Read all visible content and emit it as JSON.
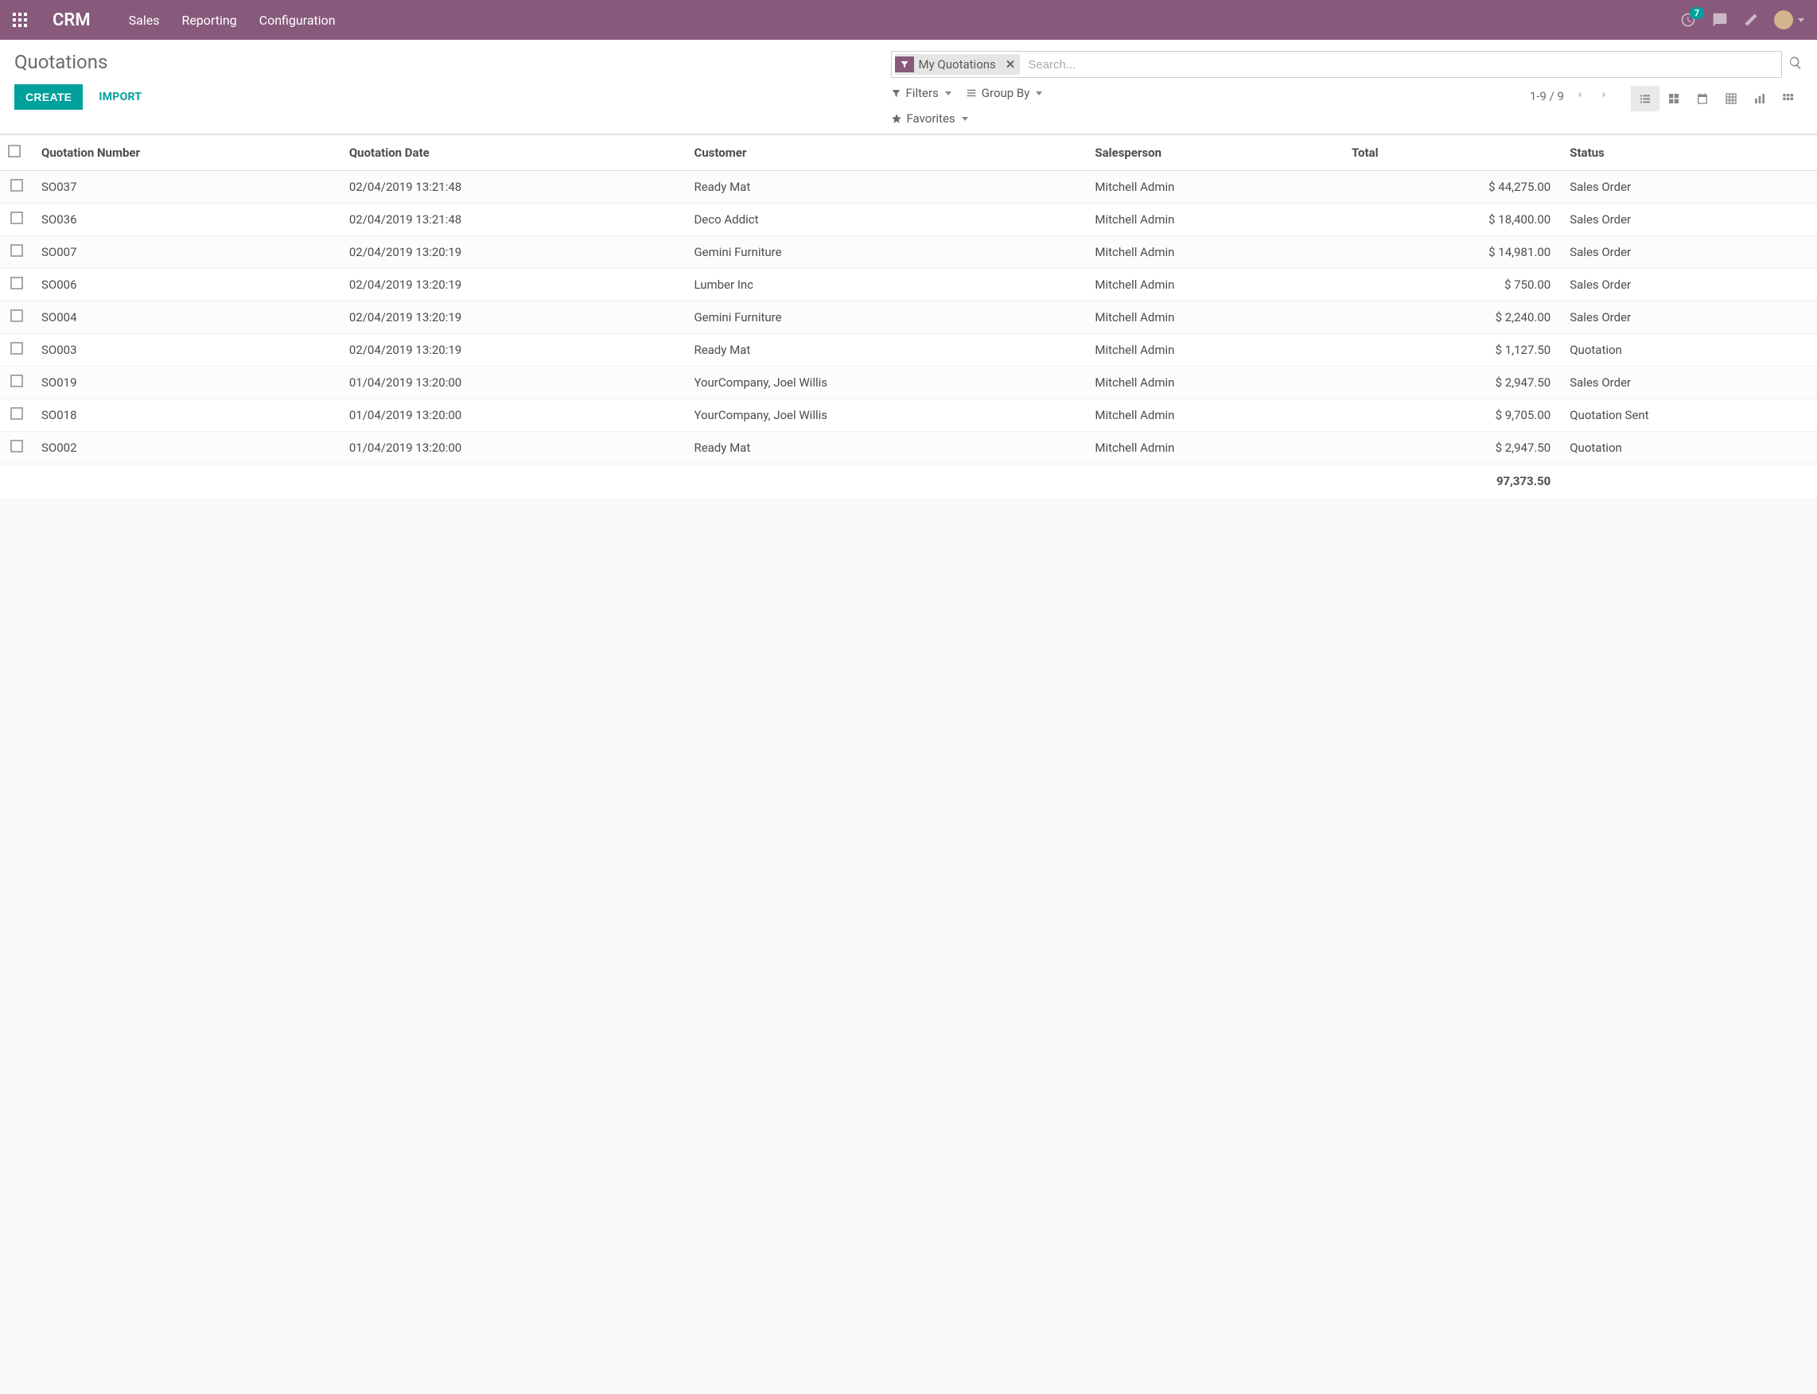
{
  "header": {
    "brand": "CRM",
    "menu": [
      "Sales",
      "Reporting",
      "Configuration"
    ],
    "notification_count": "7"
  },
  "control_panel": {
    "title": "Quotations",
    "create_label": "CREATE",
    "import_label": "IMPORT",
    "active_filter": "My Quotations",
    "search_placeholder": "Search...",
    "filters_label": "Filters",
    "groupby_label": "Group By",
    "favorites_label": "Favorites",
    "pager": "1-9 / 9"
  },
  "table": {
    "columns": {
      "number": "Quotation Number",
      "date": "Quotation Date",
      "customer": "Customer",
      "salesperson": "Salesperson",
      "total": "Total",
      "status": "Status"
    },
    "rows": [
      {
        "number": "SO037",
        "date": "02/04/2019 13:21:48",
        "customer": "Ready Mat",
        "salesperson": "Mitchell Admin",
        "total": "$ 44,275.00",
        "status": "Sales Order"
      },
      {
        "number": "SO036",
        "date": "02/04/2019 13:21:48",
        "customer": "Deco Addict",
        "salesperson": "Mitchell Admin",
        "total": "$ 18,400.00",
        "status": "Sales Order"
      },
      {
        "number": "SO007",
        "date": "02/04/2019 13:20:19",
        "customer": "Gemini Furniture",
        "salesperson": "Mitchell Admin",
        "total": "$ 14,981.00",
        "status": "Sales Order"
      },
      {
        "number": "SO006",
        "date": "02/04/2019 13:20:19",
        "customer": "Lumber Inc",
        "salesperson": "Mitchell Admin",
        "total": "$ 750.00",
        "status": "Sales Order"
      },
      {
        "number": "SO004",
        "date": "02/04/2019 13:20:19",
        "customer": "Gemini Furniture",
        "salesperson": "Mitchell Admin",
        "total": "$ 2,240.00",
        "status": "Sales Order"
      },
      {
        "number": "SO003",
        "date": "02/04/2019 13:20:19",
        "customer": "Ready Mat",
        "salesperson": "Mitchell Admin",
        "total": "$ 1,127.50",
        "status": "Quotation"
      },
      {
        "number": "SO019",
        "date": "01/04/2019 13:20:00",
        "customer": "YourCompany, Joel Willis",
        "salesperson": "Mitchell Admin",
        "total": "$ 2,947.50",
        "status": "Sales Order"
      },
      {
        "number": "SO018",
        "date": "01/04/2019 13:20:00",
        "customer": "YourCompany, Joel Willis",
        "salesperson": "Mitchell Admin",
        "total": "$ 9,705.00",
        "status": "Quotation Sent"
      },
      {
        "number": "SO002",
        "date": "01/04/2019 13:20:00",
        "customer": "Ready Mat",
        "salesperson": "Mitchell Admin",
        "total": "$ 2,947.50",
        "status": "Quotation"
      }
    ],
    "footer_total": "97,373.50"
  }
}
